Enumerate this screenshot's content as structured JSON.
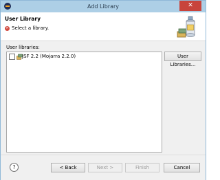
{
  "window": {
    "title": "Add Library",
    "close_glyph": "✕"
  },
  "header": {
    "title": "User Library",
    "message": "Select a library.",
    "status_icon": "error-icon",
    "status_color": "#d24a3f",
    "banner_icon": "library-jar-icon"
  },
  "main": {
    "list_label": "User libraries:",
    "libraries": [
      {
        "label": "JSF 2.2 (Mojarra 2.2.0)",
        "checked": false,
        "icon": "jar-icon"
      }
    ],
    "user_libraries_button": "User Libraries..."
  },
  "footer": {
    "help_glyph": "?",
    "back_label": "< Back",
    "next_label": "Next >",
    "finish_label": "Finish",
    "cancel_label": "Cancel"
  },
  "colors": {
    "titlebar": "#adcfe6",
    "close_button": "#c8443c",
    "panel": "#f0f0f0"
  }
}
